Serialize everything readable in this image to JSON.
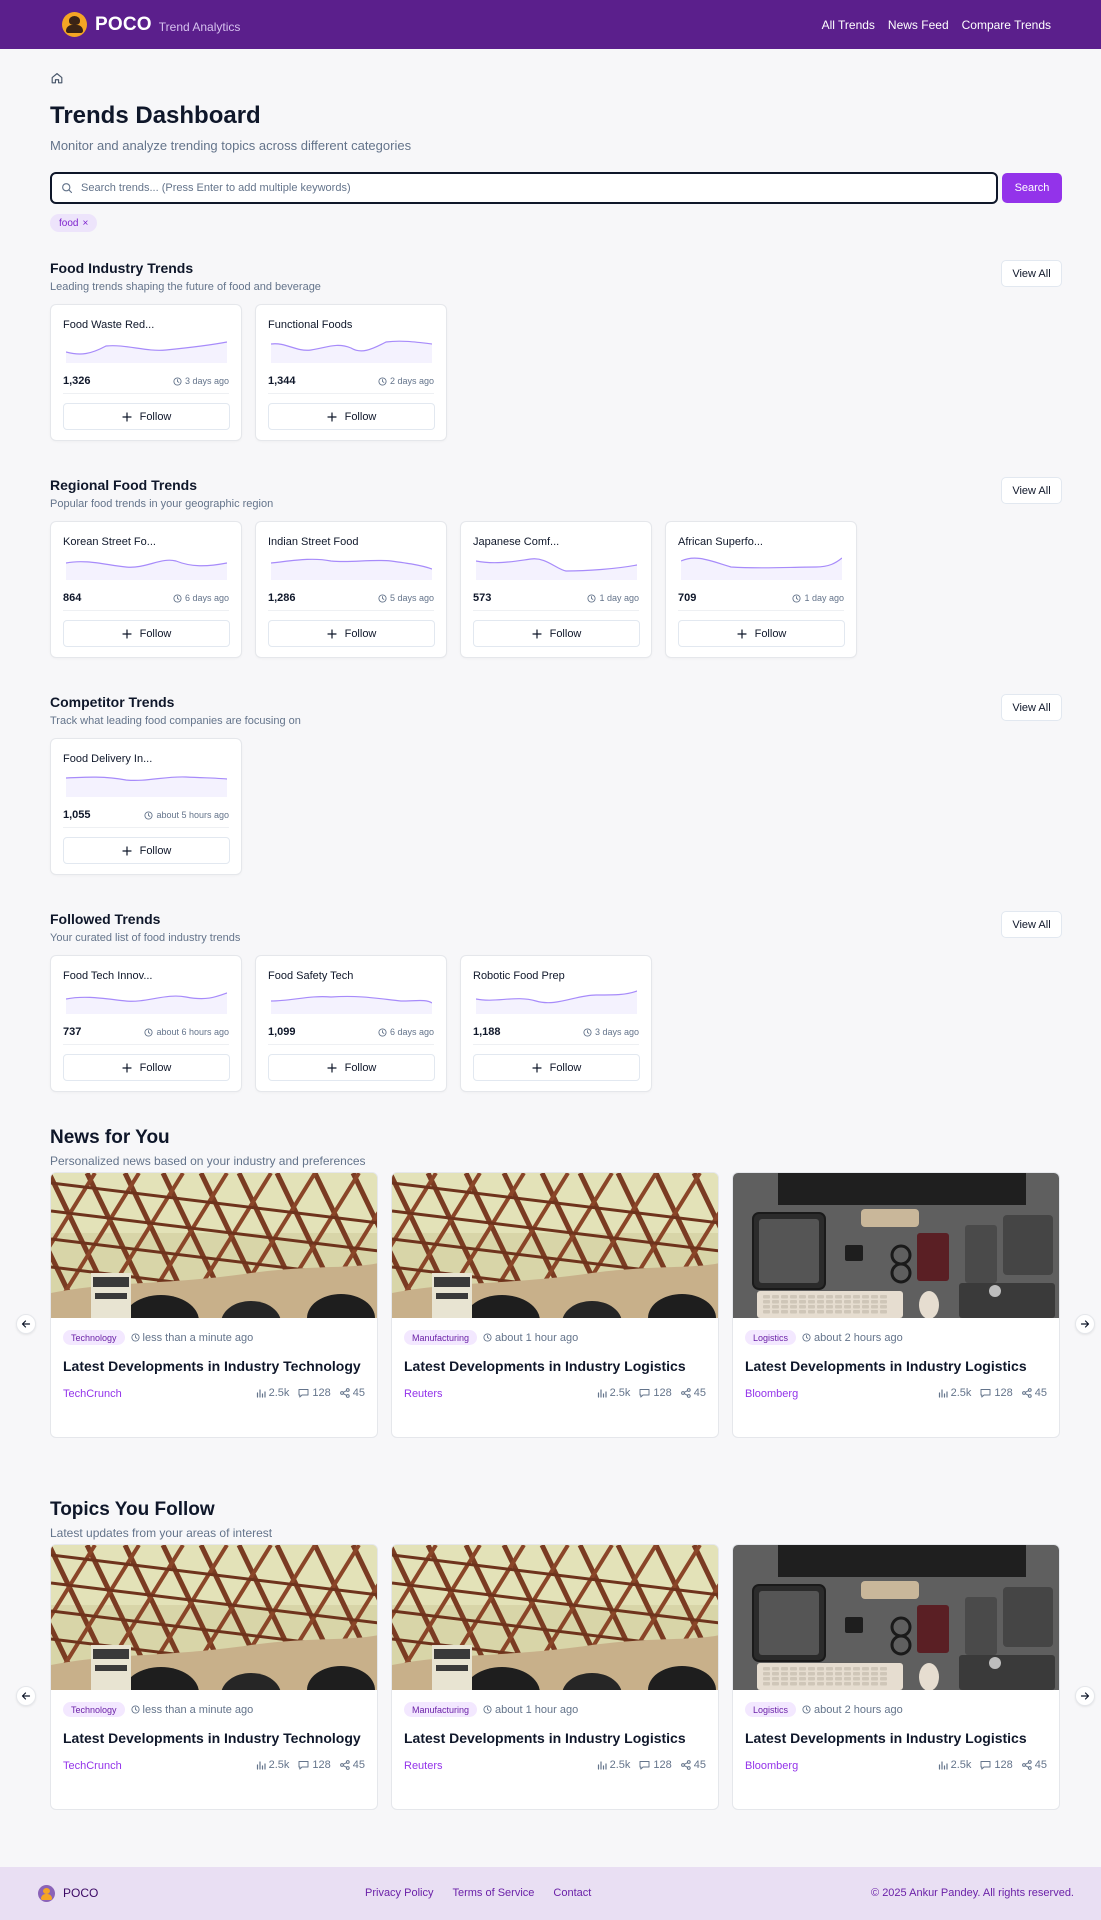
{
  "header": {
    "brand": "POCO",
    "brand_sub": "Trend Analytics",
    "nav": [
      "All Trends",
      "News Feed",
      "Compare Trends"
    ]
  },
  "page": {
    "title": "Trends Dashboard",
    "subtitle": "Monitor and analyze trending topics across different categories"
  },
  "search": {
    "placeholder": "Search trends... (Press Enter to add multiple keywords)",
    "button": "Search",
    "chips": [
      "food"
    ]
  },
  "sections": [
    {
      "title": "Food Industry Trends",
      "desc": "Leading trends shaping the future of food and beverage",
      "view_all": "View All",
      "cards": [
        {
          "name": "Food Waste Red...",
          "count": "1,326",
          "time": "3 days ago",
          "follow": "Follow"
        },
        {
          "name": "Functional Foods",
          "count": "1,344",
          "time": "2 days ago",
          "follow": "Follow"
        }
      ]
    },
    {
      "title": "Regional Food Trends",
      "desc": "Popular food trends in your geographic region",
      "view_all": "View All",
      "cards": [
        {
          "name": "Korean Street Fo...",
          "count": "864",
          "time": "6 days ago",
          "follow": "Follow"
        },
        {
          "name": "Indian Street Food",
          "count": "1,286",
          "time": "5 days ago",
          "follow": "Follow"
        },
        {
          "name": "Japanese Comf...",
          "count": "573",
          "time": "1 day ago",
          "follow": "Follow"
        },
        {
          "name": "African Superfo...",
          "count": "709",
          "time": "1 day ago",
          "follow": "Follow"
        }
      ]
    },
    {
      "title": "Competitor Trends",
      "desc": "Track what leading food companies are focusing on",
      "view_all": "View All",
      "cards": [
        {
          "name": "Food Delivery In...",
          "count": "1,055",
          "time": "about 5 hours ago",
          "follow": "Follow"
        }
      ]
    },
    {
      "title": "Followed Trends",
      "desc": "Your curated list of food industry trends",
      "view_all": "View All",
      "cards": [
        {
          "name": "Food Tech Innov...",
          "count": "737",
          "time": "about 6 hours ago",
          "follow": "Follow"
        },
        {
          "name": "Food Safety Tech",
          "count": "1,099",
          "time": "6 days ago",
          "follow": "Follow"
        },
        {
          "name": "Robotic Food Prep",
          "count": "1,188",
          "time": "3 days ago",
          "follow": "Follow"
        }
      ]
    }
  ],
  "news": {
    "title": "News for You",
    "desc": "Personalized news based on your industry and preferences",
    "items": [
      {
        "tag": "Technology",
        "time": "less than a minute ago",
        "title": "Latest Developments in Industry Technology",
        "source": "TechCrunch",
        "views": "2.5k",
        "comments": "128",
        "shares": "45",
        "image": "bridge-photo"
      },
      {
        "tag": "Manufacturing",
        "time": "about 1 hour ago",
        "title": "Latest Developments in Industry Logistics",
        "source": "Reuters",
        "views": "2.5k",
        "comments": "128",
        "shares": "45",
        "image": "bridge-photo"
      },
      {
        "tag": "Logistics",
        "time": "about 2 hours ago",
        "title": "Latest Developments in Industry Logistics",
        "source": "Bloomberg",
        "views": "2.5k",
        "comments": "128",
        "shares": "45",
        "image": "desk-photo"
      }
    ]
  },
  "topics": {
    "title": "Topics You Follow",
    "desc": "Latest updates from your areas of interest",
    "items": [
      {
        "tag": "Technology",
        "time": "less than a minute ago",
        "title": "Latest Developments in Industry Technology",
        "source": "TechCrunch",
        "views": "2.5k",
        "comments": "128",
        "shares": "45",
        "image": "bridge-photo"
      },
      {
        "tag": "Manufacturing",
        "time": "about 1 hour ago",
        "title": "Latest Developments in Industry Logistics",
        "source": "Reuters",
        "views": "2.5k",
        "comments": "128",
        "shares": "45",
        "image": "bridge-photo"
      },
      {
        "tag": "Logistics",
        "time": "about 2 hours ago",
        "title": "Latest Developments in Industry Logistics",
        "source": "Bloomberg",
        "views": "2.5k",
        "comments": "128",
        "shares": "45",
        "image": "desk-photo"
      }
    ]
  },
  "footer": {
    "brand": "POCO",
    "links": [
      "Privacy Policy",
      "Terms of Service",
      "Contact"
    ],
    "copyright": "© 2025 Ankur Pandey. All rights reserved."
  },
  "colors": {
    "header_bg": "#5b1f8c",
    "accent": "#9333ea",
    "sparkline": "#a78bfa",
    "footer_bg": "#e9dff3"
  }
}
